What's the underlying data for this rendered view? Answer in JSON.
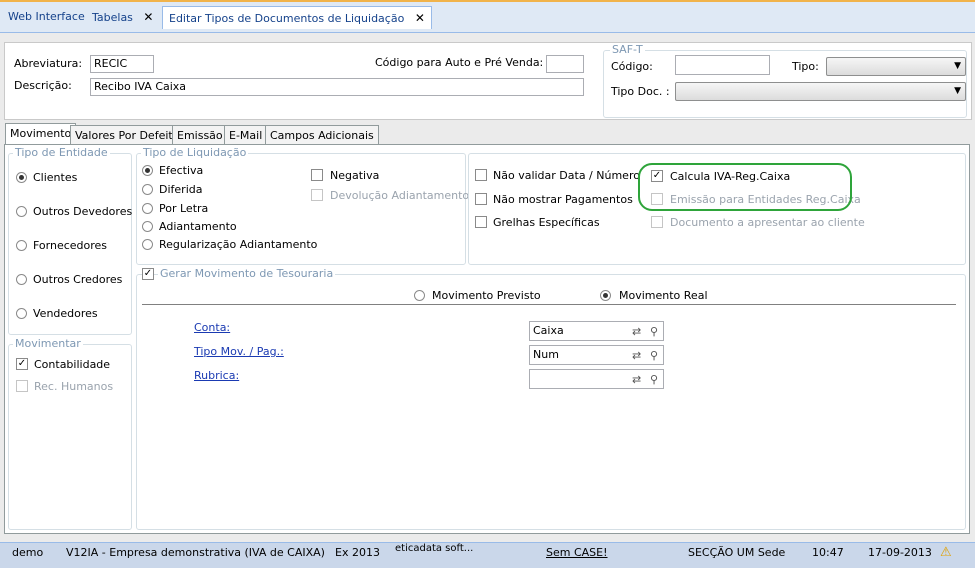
{
  "tabs": [
    {
      "label": "Web Interface"
    },
    {
      "label": "Tabelas"
    },
    {
      "label": "Editar Tipos de Documentos de Liquidação"
    }
  ],
  "header": {
    "abrev_label": "Abreviatura:",
    "abrev_value": "RECIC",
    "desc_label": "Descrição:",
    "desc_value": "Recibo IVA Caixa",
    "codigo_auto_label": "Código para Auto e Pré Venda:",
    "codigo_auto_value": "",
    "saft_legend": "SAF-T",
    "codigo_label": "Código:",
    "codigo_value": "",
    "tipo_label": "Tipo:",
    "tipo_doc_label": "Tipo Doc. :"
  },
  "inner_tabs": [
    "Movimento",
    "Valores Por Defeito",
    "Emissão",
    "E-Mail",
    "Campos Adicionais"
  ],
  "tipo_entidade": {
    "legend": "Tipo de Entidade",
    "options": [
      "Clientes",
      "Outros Devedores",
      "Fornecedores",
      "Outros Credores",
      "Vendedores"
    ],
    "selected": "Clientes"
  },
  "movimentar": {
    "legend": "Movimentar",
    "contabilidade": "Contabilidade",
    "contabilidade_checked": true,
    "rec_humanos": "Rec. Humanos",
    "rec_humanos_checked": false
  },
  "tipo_liquidacao": {
    "legend": "Tipo de Liquidação",
    "options": [
      "Efectiva",
      "Diferida",
      "Por Letra",
      "Adiantamento",
      "Regularização Adiantamento"
    ],
    "selected": "Efectiva",
    "negativa": "Negativa",
    "devolucao": "Devolução Adiantamento"
  },
  "options": {
    "nao_validar": "Não validar Data / Número",
    "nao_mostrar": "Não mostrar Pagamentos",
    "grelhas": "Grelhas Específicas",
    "calcula_iva": "Calcula IVA-Reg.Caixa",
    "emissao_entidades": "Emissão para Entidades Reg.Caixa",
    "documento_apresentar": "Documento a apresentar ao cliente"
  },
  "tesouraria": {
    "legend": "Gerar Movimento de Tesouraria",
    "checked": true,
    "previsto": "Movimento Previsto",
    "real": "Movimento Real",
    "selected": "Movimento Real",
    "conta_label": "Conta:",
    "conta_value": "Caixa",
    "tipo_mov_label": "Tipo Mov. / Pag.:",
    "tipo_mov_value": "Num",
    "rubrica_label": "Rubrica:",
    "rubrica_value": ""
  },
  "status": {
    "user": "demo",
    "empresa": "V12IA - Empresa demonstrativa (IVA de CAIXA)",
    "exercicio": "Ex 2013",
    "vendor": "eticadata soft...",
    "case": "Sem CASE!",
    "seccao": "SECÇÃO UM Sede",
    "time": "10:47",
    "date": "17-09-2013"
  },
  "colors": {
    "accent": "#15428b",
    "highlight_ring": "#2ea43a",
    "link": "#1a3ab2"
  }
}
